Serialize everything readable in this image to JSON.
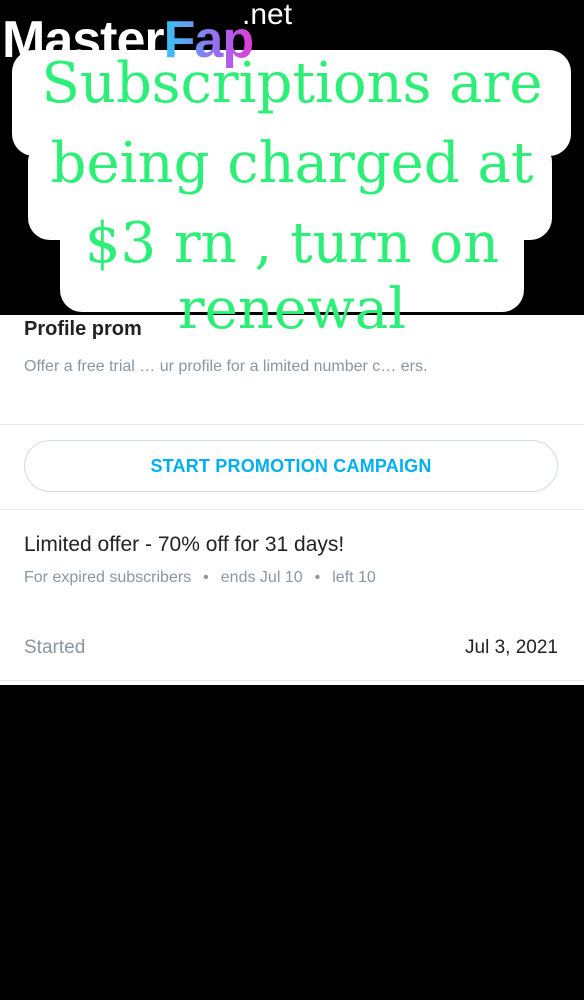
{
  "watermark": {
    "name_part1": "Master",
    "name_part2": "Fap",
    "tld": ".net"
  },
  "overlay_caption": {
    "lines": [
      "Subscriptions are",
      "being charged at",
      "$3 rn , turn on",
      "renewal"
    ],
    "color": "#2bef76"
  },
  "promotion": {
    "title": "Profile prom",
    "description": "Offer a free trial … ur profile for a limited number c… ers.",
    "button_label": "START PROMOTION CAMPAIGN"
  },
  "offer": {
    "title": "Limited offer - 70% off for 31 days!",
    "audience": "For expired subscribers",
    "ends": "ends Jul 10",
    "left": "left 10",
    "started_label": "Started",
    "started_value": "Jul 3, 2021"
  },
  "colors": {
    "accent": "#00aff0",
    "muted": "#8a96a3",
    "background": "#000000"
  }
}
